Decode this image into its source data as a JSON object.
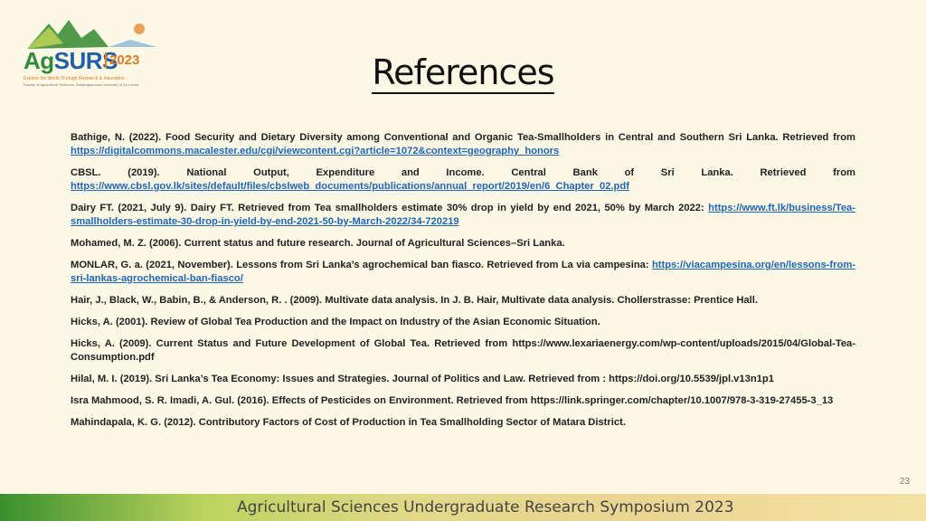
{
  "logo": {
    "name_part1": "Ag",
    "name_part2": "SURS",
    "year": "2023",
    "tagline": "Explore the World Through Research & Innovation",
    "subtag": "Faculty of Agricultural Sciences, Sabaragamuwa University of Sri Lanka"
  },
  "title": "References",
  "references": [
    {
      "text": "Bathige, N. (2022). Food Security and Dietary Diversity among Conventional and Organic Tea-Smallholders in Central and Southern Sri Lanka. Retrieved from ",
      "link": "https://digitalcommons.macalester.edu/cgi/viewcontent.cgi?article=1072&context=geography_honors"
    },
    {
      "text": "CBSL. (2019). National Output, Expenditure and Income. Central Bank of Sri Lanka. Retrieved from ",
      "link": "https://www.cbsl.gov.lk/sites/default/files/cbslweb_documents/publications/annual_report/2019/en/6_Chapter_02.pdf"
    },
    {
      "text": "Dairy FT. (2021, July 9). Dairy FT. Retrieved from Tea smallholders estimate 30% drop in yield by end 2021, 50% by March 2022: ",
      "link": "https://www.ft.lk/business/Tea-smallholders-estimate-30-drop-in-yield-by-end-2021-50-by-March-2022/34-720219"
    },
    {
      "text": "Mohamed, M. Z. (2006). Current status and future research. Journal of Agricultural Sciences–Sri Lanka.",
      "link": ""
    },
    {
      "text": "MONLAR, G. a. (2021, November). Lessons from Sri Lanka’s agrochemical ban fiasco. Retrieved from La via campesina: ",
      "link": "https://viacampesina.org/en/lessons-from-sri-lankas-agrochemical-ban-fiasco/"
    },
    {
      "text": "Hair, J., Black, W., Babin, B., & Anderson, R. . (2009). Multivate data analysis. In J. B. Hair, Multivate data analysis. Chollerstrasse: Prentice Hall.",
      "link": ""
    },
    {
      "text": "Hicks, A. (2001). Review of Global Tea Production and the Impact on Industry of the Asian Economic Situation.",
      "link": ""
    },
    {
      "text": "Hicks, A. (2009). Current Status and Future Development of Global Tea. Retrieved from https://www.lexariaenergy.com/wp-content/uploads/2015/04/Global-Tea-Consumption.pdf",
      "link": ""
    },
    {
      "text": "Hilal, M. I. (2019). Sri Lanka’s Tea Economy: Issues and Strategies. Journal of Politics and Law. Retrieved from : https://doi.org/10.5539/jpl.v13n1p1",
      "link": ""
    },
    {
      "text": "Isra Mahmood, S. R. Imadi, A. Gul. (2016). Effects of Pesticides on Environment. Retrieved from https://link.springer.com/chapter/10.1007/978-3-319-27455-3_13",
      "link": ""
    },
    {
      "text": "Mahindapala, K. G. (2012). Contributory Factors of Cost of Production in Tea Smallholding Sector of Matara District.",
      "link": ""
    }
  ],
  "footer": "Agricultural Sciences Undergraduate Research Symposium 2023",
  "page_number": "23"
}
